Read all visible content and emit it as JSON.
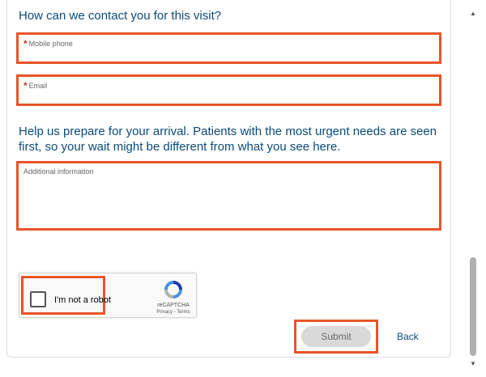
{
  "contact_section": {
    "heading": "How can we contact you for this visit?",
    "mobile_phone": {
      "required_mark": "*",
      "label": "Mobile phone",
      "value": ""
    },
    "email": {
      "required_mark": "*",
      "label": "Email",
      "value": ""
    }
  },
  "prepare_section": {
    "heading": "Help us prepare for your arrival. Patients with the most urgent needs are seen first, so your wait might be different from what you see here.",
    "additional_info": {
      "label": "Additional information",
      "value": ""
    }
  },
  "recaptcha": {
    "checkbox_label": "I'm not a robot",
    "checked": false,
    "brand": "reCAPTCHA",
    "links": "Privacy - Terms",
    "icon": "recaptcha-logo-icon"
  },
  "actions": {
    "submit_label": "Submit",
    "back_label": "Back"
  },
  "colors": {
    "heading": "#0b4a7a",
    "highlight": "#e8552a",
    "required": "#c0392b",
    "submit_bg": "#d9d9d9"
  }
}
